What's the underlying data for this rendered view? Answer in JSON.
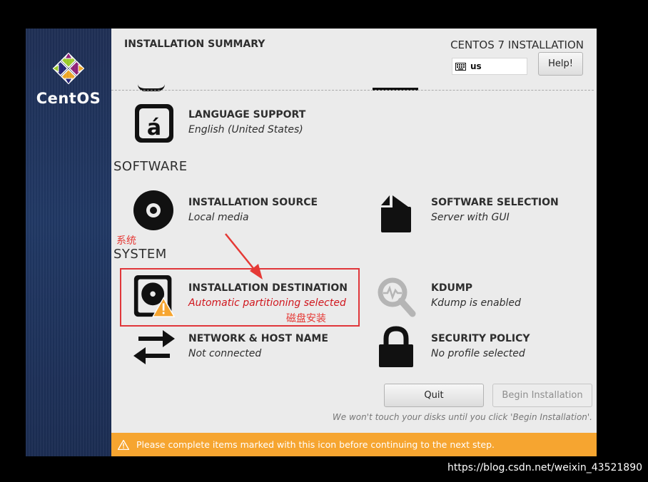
{
  "header": {
    "title": "INSTALLATION SUMMARY",
    "product": "CENTOS 7 INSTALLATION",
    "keyboard_layout": "us",
    "help_label": "Help!"
  },
  "brand": {
    "name": "CentOS"
  },
  "sections": {
    "software": "SOFTWARE",
    "system": "SYSTEM"
  },
  "spokes": {
    "language": {
      "title": "LANGUAGE SUPPORT",
      "status": "English (United States)",
      "icon": "language-icon"
    },
    "source": {
      "title": "INSTALLATION SOURCE",
      "status": "Local media",
      "icon": "disc-icon"
    },
    "software_selection": {
      "title": "SOFTWARE SELECTION",
      "status": "Server with GUI",
      "icon": "package-icon"
    },
    "destination": {
      "title": "INSTALLATION DESTINATION",
      "status": "Automatic partitioning selected",
      "icon": "harddisk-warning-icon"
    },
    "kdump": {
      "title": "KDUMP",
      "status": "Kdump is enabled",
      "icon": "magnifier-icon"
    },
    "network": {
      "title": "NETWORK & HOST NAME",
      "status": "Not connected",
      "icon": "network-arrows-icon"
    },
    "security": {
      "title": "SECURITY POLICY",
      "status": "No profile selected",
      "icon": "padlock-icon"
    }
  },
  "buttons": {
    "quit": "Quit",
    "begin": "Begin Installation"
  },
  "note": "We won't touch your disks until you click 'Begin Installation'.",
  "warning_bar": "Please complete items marked with this icon before continuing to the next step.",
  "annotations": {
    "system_label": "系统",
    "disk_install": "磁盘安装"
  },
  "watermark": "https://blog.csdn.net/weixin_43521890",
  "colors": {
    "sidebar": "#203864",
    "warning_bar": "#f6a530",
    "warning_text": "#d0161d",
    "annotation": "#e53935"
  }
}
